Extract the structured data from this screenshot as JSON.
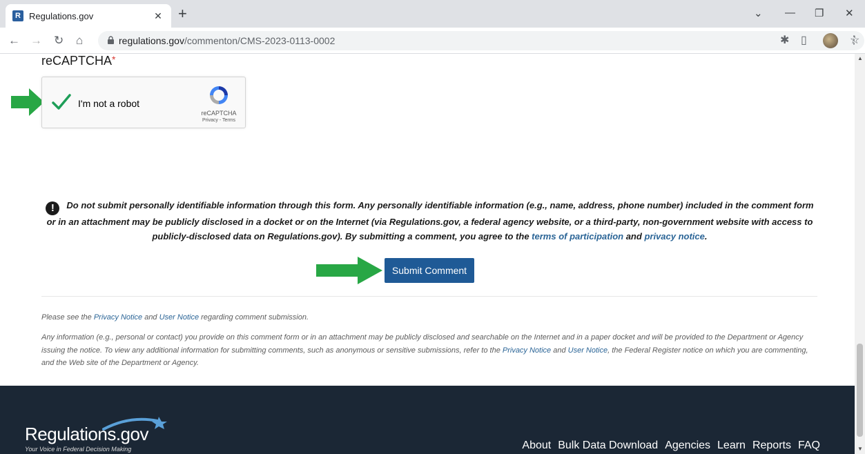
{
  "browser": {
    "tab_title": "Regulations.gov",
    "favicon_letter": "R",
    "url_domain": "regulations.gov",
    "url_path": "/commenton/CMS-2023-0113-0002"
  },
  "recaptcha": {
    "heading": "reCAPTCHA",
    "required_mark": "*",
    "checkbox_label": "I'm not a robot",
    "brand": "reCAPTCHA",
    "privacy": "Privacy",
    "separator": " - ",
    "terms": "Terms"
  },
  "warning": {
    "text": "Do not submit personally identifiable information through this form. Any personally identifiable information (e.g., name, address, phone number) included in the comment form or in an attachment may be publicly disclosed in a docket or on the Internet (via Regulations.gov, a federal agency website, or a third-party, non-government website with access to publicly-disclosed data on Regulations.gov). By submitting a comment, you agree to the ",
    "terms_link": "terms of participation",
    "and": " and ",
    "privacy_link": "privacy notice",
    "end": "."
  },
  "submit_label": "Submit Comment",
  "notes": {
    "line1_pre": "Please see the ",
    "privacy_notice": "Privacy Notice",
    "and": " and ",
    "user_notice": "User Notice",
    "line1_post": " regarding comment submission.",
    "line2_pre": "Any information (e.g., personal or contact) you provide on this comment form or in an attachment may be publicly disclosed and searchable on the Internet and in a paper docket and will be provided to the Department or Agency issuing the notice. To view any additional information for submitting comments, such as anonymous or sensitive submissions, refer to the ",
    "line2_mid": ", the Federal Register notice on which you are commenting, and the Web site of the Department or Agency.",
    "user_notice_comma": "User Notice"
  },
  "footer": {
    "logo": "Regulations.gov",
    "tagline": "Your Voice in Federal Decision Making",
    "nav": [
      "About",
      "Bulk Data Download",
      "Agencies",
      "Learn",
      "Reports",
      "FAQ"
    ]
  },
  "colors": {
    "primary_button": "#1f5a96",
    "link": "#2a6496",
    "arrow_green": "#28a745",
    "footer_bg": "#1b2735"
  },
  "icons": {
    "annotation": "green-arrow-icon",
    "check": "checkmark-icon",
    "warning": "exclamation-circle-icon"
  }
}
